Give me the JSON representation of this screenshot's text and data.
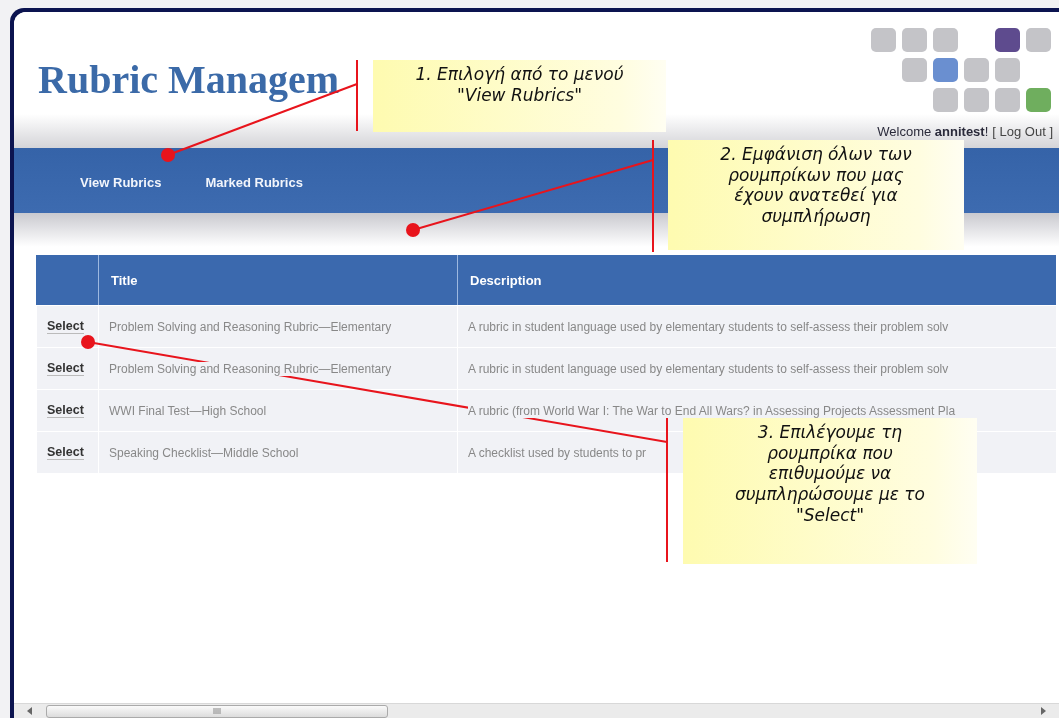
{
  "header": {
    "title": "Rubric Managem",
    "welcome": "Welcome **annitest**!",
    "logout": "[ Log Out ]"
  },
  "nav": {
    "items": [
      "View Rubrics",
      "Marked Rubrics"
    ]
  },
  "table": {
    "columns": [
      "Title",
      "Description"
    ],
    "rows": [
      {
        "action": "Select",
        "title": "Problem Solving and Reasoning Rubric—Elementary",
        "description": "A rubric in student language used by elementary students to self-assess their problem solv"
      },
      {
        "action": "Select",
        "title": "Problem Solving and Reasoning Rubric—Elementary",
        "description": "A rubric in student language used by elementary students to self-assess their problem solv"
      },
      {
        "action": "Select",
        "title": "WWI Final Test—High School",
        "description": "A rubric (from World War I: The War to End All Wars? in Assessing Projects Assessment Pla"
      },
      {
        "action": "Select",
        "title": "Speaking Checklist—Middle School",
        "description": "A checklist used by students to pr"
      }
    ]
  },
  "callouts": [
    {
      "lines": [
        "1. Επιλογή από το μενού",
        "\"View Rubrics\""
      ]
    },
    {
      "lines": [
        "2. Εμφάνιση όλων των",
        "ρουμπρίκων που μας",
        "έχουν ανατεθεί για",
        "συμπλήρωση"
      ]
    },
    {
      "lines": [
        "3. Επιλέγουμε τη",
        "ρουμπρίκα που",
        "επιθυμούμε να",
        "συμπληρώσουμε με το",
        "\"Select\""
      ]
    }
  ]
}
